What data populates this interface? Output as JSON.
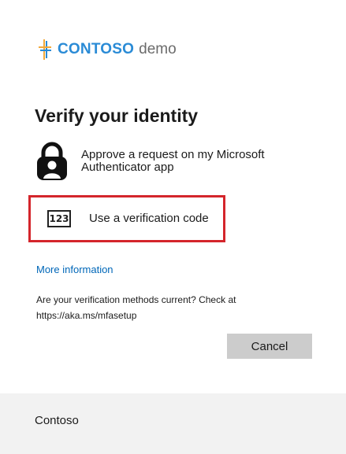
{
  "brand": {
    "name": "CONTOSO",
    "suffix": "demo",
    "icon": "contoso-logo-icon",
    "colors": {
      "brand_blue": "#2a8bd6",
      "brand_orange": "#f2a93b"
    }
  },
  "page": {
    "title": "Verify your identity"
  },
  "options": [
    {
      "icon": "authenticator-lock-icon",
      "label": "Approve a request on my Microsoft Authenticator app"
    },
    {
      "icon": "verification-code-icon",
      "icon_text": "123",
      "label": "Use a verification code",
      "highlight_color": "#d4252b"
    }
  ],
  "links": {
    "more_info": "More information"
  },
  "notice": {
    "text": "Are your verification methods current? Check at https://aka.ms/mfasetup"
  },
  "buttons": {
    "cancel": "Cancel"
  },
  "footer": {
    "org_name": "Contoso"
  }
}
